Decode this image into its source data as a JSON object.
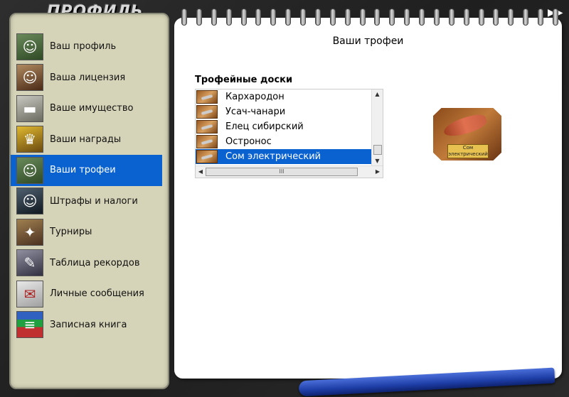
{
  "app": {
    "title": "ПРОФИЛЬ",
    "collapse_glyph": "▶▶"
  },
  "sidebar": {
    "items": [
      {
        "label": "Ваш профиль",
        "icon": "angler-portrait-icon",
        "active": false
      },
      {
        "label": "Ваша лицензия",
        "icon": "license-officer-icon",
        "active": false
      },
      {
        "label": "Ваше имущество",
        "icon": "camper-van-icon",
        "active": false
      },
      {
        "label": "Ваши награды",
        "icon": "trophy-cups-icon",
        "active": false
      },
      {
        "label": "Ваши трофеи",
        "icon": "angler-trophy-icon",
        "active": true
      },
      {
        "label": "Штрафы и налоги",
        "icon": "inspector-icon",
        "active": false
      },
      {
        "label": "Турниры",
        "icon": "tournament-emblem-icon",
        "active": false
      },
      {
        "label": "Таблица рекордов",
        "icon": "records-podium-icon",
        "active": false
      },
      {
        "label": "Личные сообщения",
        "icon": "envelope-icon",
        "active": false
      },
      {
        "label": "Записная книга",
        "icon": "books-stack-icon",
        "active": false
      }
    ]
  },
  "main": {
    "title": "Ваши трофеи",
    "boards_label": "Трофейные доски",
    "boards": [
      {
        "label": "Кархародон",
        "selected": false
      },
      {
        "label": "Усач-чанари",
        "selected": false
      },
      {
        "label": "Елец сибирский",
        "selected": false
      },
      {
        "label": "Остронос",
        "selected": false
      },
      {
        "label": "Сом электрический",
        "selected": true
      }
    ],
    "hscroll_grip": "III",
    "preview_label": "Сом электрический"
  },
  "colors": {
    "accent": "#0a62d0",
    "sidebar_bg": "#d6d4b8"
  }
}
